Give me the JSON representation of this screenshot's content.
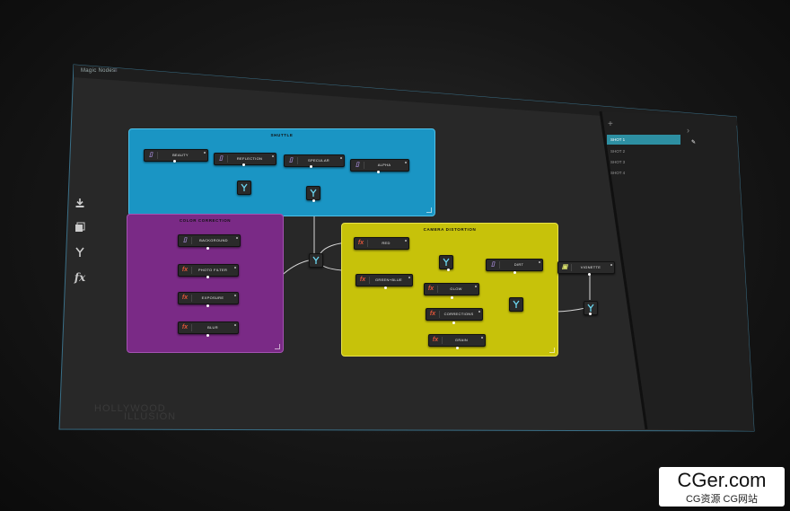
{
  "app": {
    "title": "Magic Nodes",
    "menu_icon": "hamburger-icon"
  },
  "toolbar": [
    {
      "name": "import-icon"
    },
    {
      "name": "layers-icon"
    },
    {
      "name": "merge-icon"
    },
    {
      "name": "fx-icon",
      "label": "fx"
    }
  ],
  "groups": {
    "shuttle": {
      "title": "SHUTTLE",
      "color": "#1a95c4"
    },
    "color_correction": {
      "title": "COLOR CORRECTION",
      "color": "#7a2a86"
    },
    "camera_distortion": {
      "title": "CAMERA DISTORTION",
      "color": "#c7c20a"
    }
  },
  "nodes": {
    "beauty": "BEAUTY",
    "reflection": "REFLECTION",
    "specular": "SPECULAR",
    "alpha": "ALPHA",
    "background": "BACKGROUND",
    "photo_filter": "PHOTO FILTER",
    "exposure": "EXPOSURE",
    "blur": "BLUR",
    "red": "RED",
    "green_blue": "GREEN+BLUE",
    "glow": "GLOW",
    "corrections": "CORRECTIONS",
    "grain": "GRAIN",
    "dirt": "DIRT",
    "vignette": "VIGNETTE"
  },
  "shots": {
    "items": [
      "SHOT 1",
      "SHOT 2",
      "SHOT 3",
      "SHOT 4"
    ],
    "active": "SHOT 1"
  },
  "branding": {
    "line1": "HOLLYWOOD",
    "line2": "ILLUSION"
  },
  "watermark": {
    "line1": "CGer.com",
    "line2": "CG资源 CG网站"
  },
  "colors": {
    "accent": "#2d8fa2",
    "fx": "#e0553a",
    "doc": "#a58ad6"
  }
}
